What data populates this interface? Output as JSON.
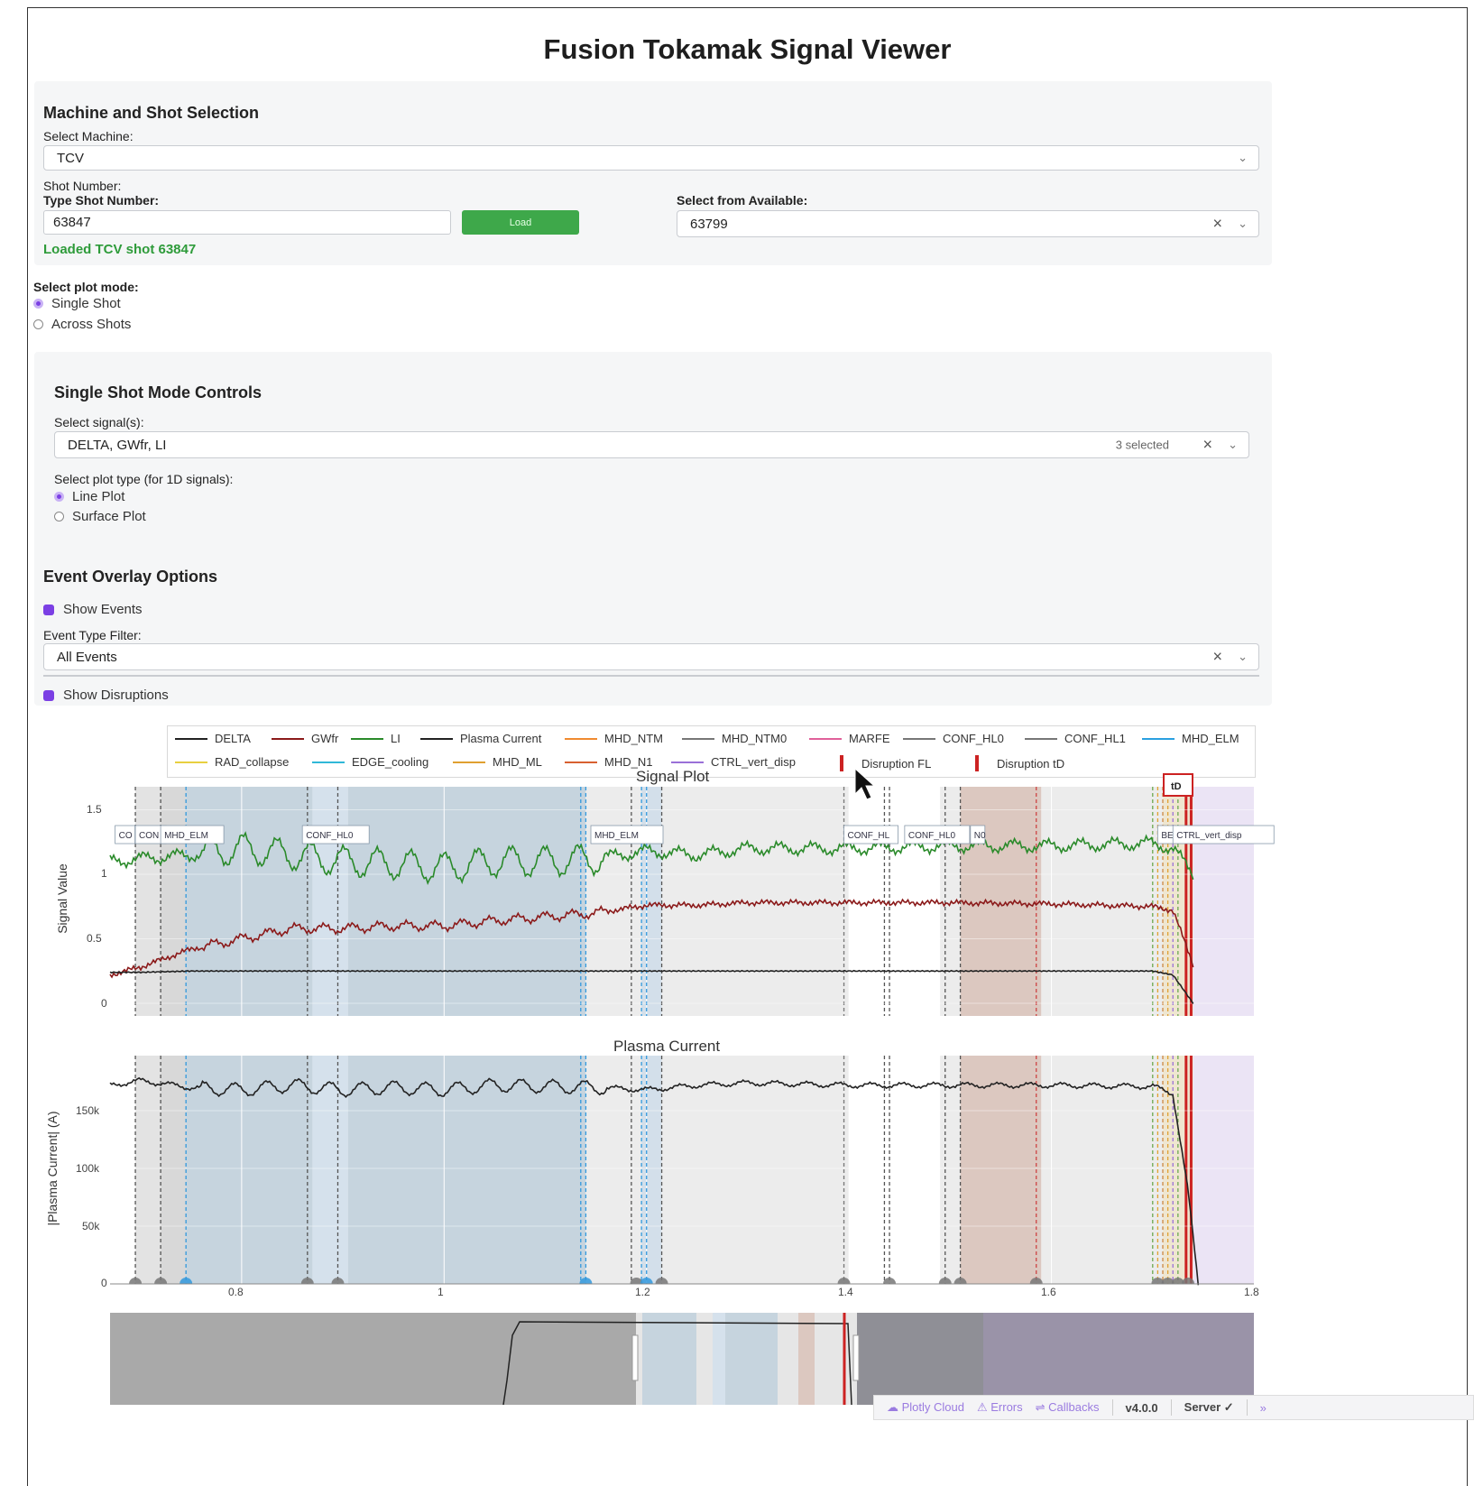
{
  "app_title": "Fusion Tokamak Signal Viewer",
  "machine_section": {
    "heading": "Machine and Shot Selection",
    "machine_label": "Select Machine:",
    "machine_value": "TCV",
    "shot_number_label": "Shot Number:",
    "type_shot_label": "Type Shot Number:",
    "shot_input_value": "63847",
    "load_button": "Load",
    "available_label": "Select from Available:",
    "available_value": "63799",
    "status": "Loaded TCV shot 63847"
  },
  "plot_mode": {
    "label": "Select plot mode:",
    "options": [
      "Single Shot",
      "Across Shots"
    ],
    "selected": "Single Shot"
  },
  "single_shot": {
    "heading": "Single Shot Mode Controls",
    "signals_label": "Select signal(s):",
    "signals_value": "DELTA, GWfr, LI",
    "signals_count": "3 selected",
    "plot_type_label": "Select plot type (for 1D signals):",
    "plot_type_options": [
      "Line Plot",
      "Surface Plot"
    ],
    "plot_type_selected": "Line Plot"
  },
  "events": {
    "heading": "Event Overlay Options",
    "show_events": "Show Events",
    "filter_label": "Event Type Filter:",
    "filter_value": "All Events",
    "show_disruptions": "Show Disruptions"
  },
  "legend": [
    {
      "name": "DELTA",
      "color": "#222222",
      "kind": "line"
    },
    {
      "name": "GWfr",
      "color": "#8b1a1a",
      "kind": "line"
    },
    {
      "name": "LI",
      "color": "#2a8a2a",
      "kind": "line"
    },
    {
      "name": "Plasma Current",
      "color": "#222222",
      "kind": "line"
    },
    {
      "name": "MHD_NTM",
      "color": "#f08a30",
      "kind": "line"
    },
    {
      "name": "MHD_NTM0",
      "color": "#777777",
      "kind": "line"
    },
    {
      "name": "MARFE",
      "color": "#e0609a",
      "kind": "line"
    },
    {
      "name": "CONF_HL0",
      "color": "#777777",
      "kind": "line"
    },
    {
      "name": "CONF_HL1",
      "color": "#777777",
      "kind": "line"
    },
    {
      "name": "MHD_ELM",
      "color": "#2aa0e0",
      "kind": "line"
    },
    {
      "name": "RAD_collapse",
      "color": "#e8d040",
      "kind": "line"
    },
    {
      "name": "EDGE_cooling",
      "color": "#30b8d8",
      "kind": "line"
    },
    {
      "name": "MHD_ML",
      "color": "#e0a030",
      "kind": "line"
    },
    {
      "name": "MHD_N1",
      "color": "#d86030",
      "kind": "line"
    },
    {
      "name": "CTRL_vert_disp",
      "color": "#9a70d8",
      "kind": "line"
    },
    {
      "name": "Disruption FL",
      "color": "#cc2222",
      "kind": "bar"
    },
    {
      "name": "Disruption tD",
      "color": "#cc2222",
      "kind": "bar"
    }
  ],
  "signal_plot": {
    "title": "Signal Plot",
    "ylabel": "Signal Value",
    "y_ticks": [
      "0",
      "0.5",
      "1",
      "1.5"
    ],
    "event_labels": [
      "CO",
      "CON",
      "MHD_ELM",
      "CONF_HL0",
      "MHD_ELM",
      "CONF_HL",
      "CONF_HL0",
      "N0",
      "BE",
      "CTRL_vert_disp"
    ],
    "td_label": "tD"
  },
  "current_plot": {
    "title": "Plasma Current",
    "ylabel": "|Plasma Current| (A)",
    "y_ticks": [
      "0",
      "50k",
      "100k",
      "150k"
    ]
  },
  "x_ticks": [
    "0.8",
    "1",
    "1.2",
    "1.4",
    "1.6",
    "1.8"
  ],
  "chart_data": {
    "type": "line",
    "x_range": [
      0.67,
      1.8
    ],
    "series": [
      {
        "name": "LI",
        "color": "#2a8a2a",
        "x": [
          0.67,
          0.7,
          0.75,
          0.8,
          0.85,
          0.9,
          0.95,
          1.0,
          1.05,
          1.1,
          1.15,
          1.2,
          1.25,
          1.3,
          1.4,
          1.5,
          1.6,
          1.7,
          1.72,
          1.74
        ],
        "y": [
          1.1,
          1.12,
          1.15,
          1.2,
          1.15,
          1.1,
          1.08,
          1.05,
          1.1,
          1.1,
          1.12,
          1.18,
          1.15,
          1.2,
          1.2,
          1.22,
          1.22,
          1.24,
          1.2,
          1.0
        ]
      },
      {
        "name": "GWfr",
        "color": "#8b1a1a",
        "x": [
          0.67,
          0.7,
          0.75,
          0.8,
          0.85,
          0.9,
          0.95,
          1.0,
          1.05,
          1.1,
          1.15,
          1.2,
          1.25,
          1.3,
          1.4,
          1.5,
          1.6,
          1.7,
          1.72,
          1.74
        ],
        "y": [
          0.22,
          0.28,
          0.42,
          0.5,
          0.58,
          0.58,
          0.6,
          0.6,
          0.64,
          0.67,
          0.7,
          0.76,
          0.76,
          0.78,
          0.78,
          0.78,
          0.77,
          0.75,
          0.72,
          0.3
        ]
      },
      {
        "name": "DELTA",
        "color": "#222222",
        "x": [
          0.67,
          0.7,
          0.75,
          0.8,
          0.9,
          1.0,
          1.1,
          1.2,
          1.3,
          1.4,
          1.5,
          1.6,
          1.7,
          1.72,
          1.74
        ],
        "y": [
          0.24,
          0.24,
          0.25,
          0.25,
          0.25,
          0.25,
          0.25,
          0.25,
          0.25,
          0.25,
          0.25,
          0.25,
          0.25,
          0.22,
          0.0
        ]
      },
      {
        "name": "Plasma Current",
        "color": "#222222",
        "x": [
          0.67,
          0.7,
          0.75,
          0.8,
          0.85,
          0.9,
          0.95,
          1.0,
          1.05,
          1.1,
          1.15,
          1.2,
          1.25,
          1.3,
          1.4,
          1.5,
          1.6,
          1.7,
          1.72,
          1.735,
          1.745
        ],
        "y": [
          172000,
          176000,
          170000,
          168000,
          172000,
          168000,
          170000,
          168000,
          172000,
          171000,
          170000,
          168000,
          172000,
          174000,
          172000,
          172000,
          172000,
          171000,
          165000,
          80000,
          0
        ]
      }
    ]
  }
}
